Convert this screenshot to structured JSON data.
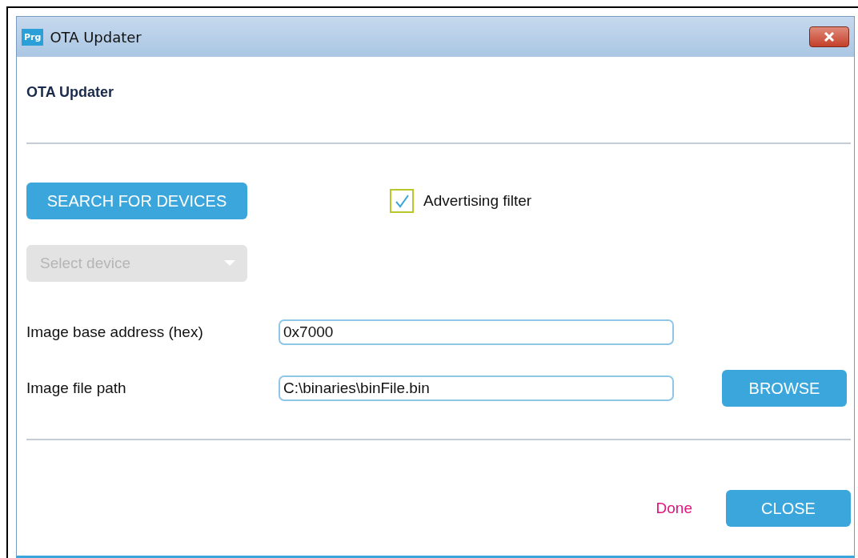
{
  "window": {
    "app_icon": "Prg",
    "title": "OTA Updater"
  },
  "heading": "OTA Updater",
  "search_button": "SEARCH FOR DEVICES",
  "advertising_filter": {
    "label": "Advertising filter",
    "checked": true
  },
  "device_select": {
    "placeholder": "Select device",
    "disabled": true
  },
  "fields": [
    {
      "label": "Image base address (hex)",
      "value": "0x7000"
    },
    {
      "label": "Image file path",
      "value": "C:\\binaries\\binFile.bin",
      "button": "BROWSE"
    }
  ],
  "status": "Done",
  "close_button": "CLOSE"
}
